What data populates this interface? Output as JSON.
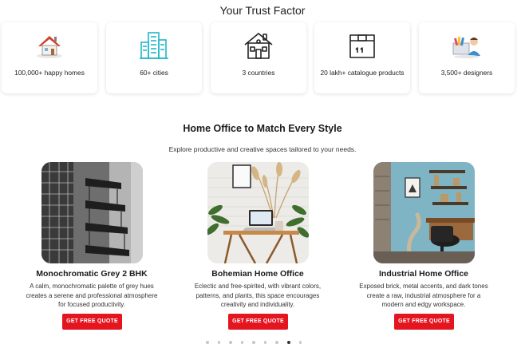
{
  "trust": {
    "title": "Your Trust Factor",
    "items": [
      {
        "label": "100,000+ happy homes",
        "icon": "house-icon"
      },
      {
        "label": "60+ cities",
        "icon": "buildings-icon"
      },
      {
        "label": "3 countries",
        "icon": "home-outline-icon"
      },
      {
        "label": "20 lakh+ catalogue products",
        "icon": "box-icon"
      },
      {
        "label": "3,500+ designers",
        "icon": "designer-icon"
      }
    ]
  },
  "section": {
    "title": "Home Office to Match Every Style",
    "subtitle": "Explore productive and creative spaces tailored to your needs."
  },
  "cards": [
    {
      "title": "Monochromatic Grey 2 BHK",
      "desc": "A calm, monochromatic palette of grey hues creates a serene and professional atmosphere for focused productivity.",
      "button": "GET FREE QUOTE"
    },
    {
      "title": "Bohemian Home Office",
      "desc": "Eclectic and free-spirited, with vibrant colors, patterns, and plants, this space encourages creativity and individuality.",
      "button": "GET FREE QUOTE"
    },
    {
      "title": "Industrial Home Office",
      "desc": "Exposed brick, metal accents, and dark tones create a raw, industrial atmosphere for a modern and edgy workspace.",
      "button": "GET FREE QUOTE"
    }
  ],
  "carousel": {
    "total": 9,
    "active_index": 7
  },
  "colors": {
    "accent": "#e4151f",
    "icon_teal": "#1fb7c9"
  }
}
